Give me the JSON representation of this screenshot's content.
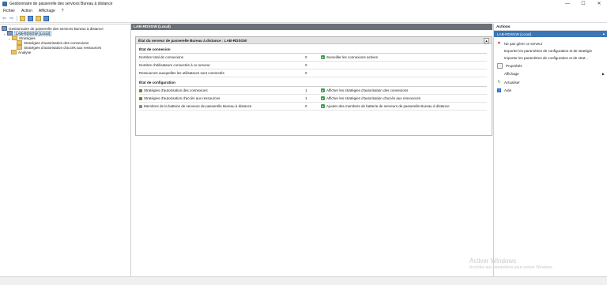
{
  "window": {
    "title": "Gestionnaire de passerelle des services Bureau à distance",
    "minimize": "—",
    "maximize": "☐",
    "close": "✕"
  },
  "menu": [
    "Fichier",
    "Action",
    "Affichage",
    "?"
  ],
  "tree": {
    "root": "Gestionnaire de passerelle des services Bureau à distance",
    "server": "LAB-RDSGW (Local)",
    "policies": "Stratégies",
    "cap": "Stratégies d'autorisation des connexions",
    "rap": "Stratégies d'autorisation d'accès aux ressources",
    "monitoring": "Analyse"
  },
  "center": {
    "header": "LAB-RDSGW (Local)",
    "panel_title": "État du serveur de passerelle Bureau à distance : LAB-RDSGW",
    "connection": {
      "heading": "État de connexion",
      "rows": [
        {
          "label": "Nombre total de connexions",
          "value": "0",
          "action": "Surveiller les connexions actives"
        },
        {
          "label": "Nombre d'utilisateurs connectés à ce serveur",
          "value": "0",
          "action": ""
        },
        {
          "label": "Ressources auxquelles les utilisateurs sont connectés",
          "value": "0",
          "action": ""
        }
      ]
    },
    "config": {
      "heading": "État de configuration",
      "rows": [
        {
          "label": "Stratégies d'autorisation des connexions",
          "value": "1",
          "action": "Afficher les stratégies d'autorisation des connexions"
        },
        {
          "label": "Stratégies d'autorisation d'accès aux ressources",
          "value": "1",
          "action": "Afficher les stratégies d'autorisation d'accès aux ressources"
        },
        {
          "label": "Membres de la batterie de serveurs de passerelle Bureau à distance",
          "value": "0",
          "action": "Ajouter des membres de batterie de serveurs de passerelle Bureau à distance"
        }
      ]
    }
  },
  "actions": {
    "title": "Actions",
    "subheader": "LAB-RDSGW (Local)",
    "items": [
      {
        "label": "Ne pas gérer ce serveur",
        "icon": "red-x-icon"
      },
      {
        "label": "Exporter les paramètres de configuration et de stratégie",
        "icon": ""
      },
      {
        "label": "Importer les paramètres de configuration et de strat...",
        "icon": ""
      },
      {
        "label": "Propriétés",
        "icon": "properties-icon"
      },
      {
        "label": "Affichage",
        "icon": "",
        "submenu": "▶"
      },
      {
        "label": "Actualiser",
        "icon": "refresh-icon"
      },
      {
        "label": "Aide",
        "icon": "help-icon"
      }
    ]
  },
  "watermark": {
    "line1": "Activer Windows",
    "line2": "Accédez aux paramètres pour activer Windows."
  }
}
